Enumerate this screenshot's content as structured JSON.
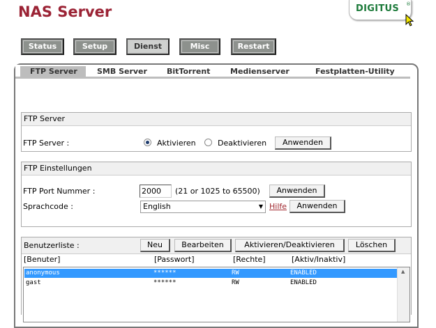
{
  "app": {
    "title": "NAS Server",
    "brand": "DIGITUS",
    "brand_mark": "®"
  },
  "nav": [
    {
      "label": "Status",
      "active": false
    },
    {
      "label": "Setup",
      "active": false
    },
    {
      "label": "Dienst",
      "active": true
    },
    {
      "label": "Misc",
      "active": false
    },
    {
      "label": "Restart",
      "active": false
    }
  ],
  "tabs": [
    {
      "label": "FTP Server",
      "active": true
    },
    {
      "label": "SMB Server",
      "active": false
    },
    {
      "label": "BitTorrent",
      "active": false
    },
    {
      "label": "Medienserver",
      "active": false
    },
    {
      "label": "Festplatten-Utility",
      "active": false
    }
  ],
  "ftp_server": {
    "heading": "FTP Server",
    "field_label": "FTP Server :",
    "enable_label": "Aktivieren",
    "disable_label": "Deaktivieren",
    "selected": "Aktivieren",
    "apply_label": "Anwenden"
  },
  "ftp_settings": {
    "heading": "FTP Einstellungen",
    "port_label": "FTP Port Nummer :",
    "port_value": "2000",
    "port_hint": "(21 or 1025 to 65500)",
    "port_apply": "Anwenden",
    "lang_label": "Sprachcode :",
    "lang_value": "English",
    "help_link": "Hilfe",
    "lang_apply": "Anwenden"
  },
  "users": {
    "heading": "Benutzerliste :",
    "new_label": "Neu",
    "edit_label": "Bearbeiten",
    "toggle_label": "Aktivieren/Deaktivieren",
    "delete_label": "Löschen",
    "columns": [
      "[Benuter]",
      "[Passwort]",
      "[Rechte]",
      "[Aktiv/Inaktiv]"
    ],
    "rows": [
      {
        "user": "anonymous",
        "password": "******",
        "rights": "RW",
        "status": "ENABLED",
        "selected": true
      },
      {
        "user": "gast",
        "password": "******",
        "rights": "RW",
        "status": "ENABLED",
        "selected": false
      }
    ]
  },
  "colors": {
    "title": "#9b2335",
    "brand": "#1c7a3a",
    "nav_bg": "#8d918d",
    "selection": "#3399ff",
    "link": "#a0262d"
  }
}
